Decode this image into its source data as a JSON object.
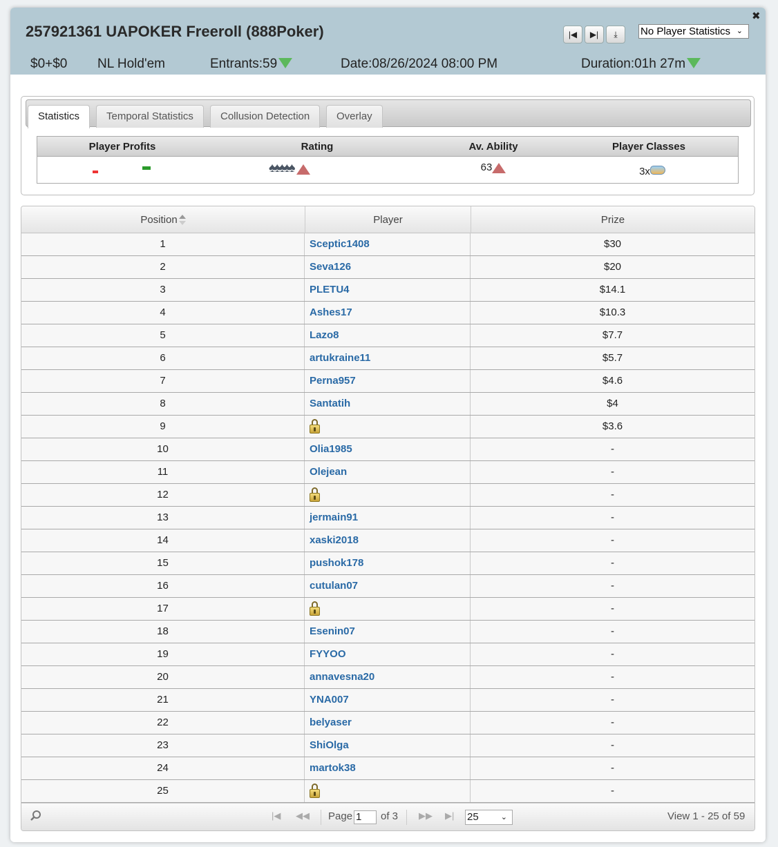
{
  "header": {
    "title": "257921361 UAPOKER Freeroll (888Poker)",
    "close_label": "✖",
    "stats_select": "No Player Statistics",
    "buyin": "$0+$0",
    "game": "NL Hold'em",
    "entrants": "Entrants:59",
    "date": "Date:08/26/2024 08:00 PM",
    "duration": "Duration:01h 27m"
  },
  "tabs": [
    "Statistics",
    "Temporal Statistics",
    "Collusion Detection",
    "Overlay"
  ],
  "summary": {
    "headers": [
      "Player Profits",
      "Rating",
      "Av. Ability",
      "Player Classes"
    ],
    "rating_icons": "♠♠♠♠♠",
    "ability": "63",
    "player_classes": "3x"
  },
  "grid": {
    "headers": [
      "Position",
      "Player",
      "Prize"
    ],
    "rows": [
      {
        "pos": "1",
        "player": "Sceptic1408",
        "prize": "$30"
      },
      {
        "pos": "2",
        "player": "Seva126",
        "prize": "$20"
      },
      {
        "pos": "3",
        "player": "PLETU4",
        "prize": "$14.1"
      },
      {
        "pos": "4",
        "player": "Ashes17",
        "prize": "$10.3"
      },
      {
        "pos": "5",
        "player": "Lazo8",
        "prize": "$7.7"
      },
      {
        "pos": "6",
        "player": "artukraine11",
        "prize": "$5.7"
      },
      {
        "pos": "7",
        "player": "Perna957",
        "prize": "$4.6"
      },
      {
        "pos": "8",
        "player": "Santatih",
        "prize": "$4"
      },
      {
        "pos": "9",
        "player": "",
        "prize": "$3.6"
      },
      {
        "pos": "10",
        "player": "Olia1985",
        "prize": "-"
      },
      {
        "pos": "11",
        "player": "Olejean",
        "prize": "-"
      },
      {
        "pos": "12",
        "player": "",
        "prize": "-"
      },
      {
        "pos": "13",
        "player": "jermain91",
        "prize": "-"
      },
      {
        "pos": "14",
        "player": "xaski2018",
        "prize": "-"
      },
      {
        "pos": "15",
        "player": "pushok178",
        "prize": "-"
      },
      {
        "pos": "16",
        "player": "cutulan07",
        "prize": "-"
      },
      {
        "pos": "17",
        "player": "",
        "prize": "-"
      },
      {
        "pos": "18",
        "player": "Esenin07",
        "prize": "-"
      },
      {
        "pos": "19",
        "player": "FYYOO",
        "prize": "-"
      },
      {
        "pos": "20",
        "player": "annavesna20",
        "prize": "-"
      },
      {
        "pos": "21",
        "player": "YNA007",
        "prize": "-"
      },
      {
        "pos": "22",
        "player": "belyaser",
        "prize": "-"
      },
      {
        "pos": "23",
        "player": "ShiOlga",
        "prize": "-"
      },
      {
        "pos": "24",
        "player": "martok38",
        "prize": "-"
      },
      {
        "pos": "25",
        "player": "",
        "prize": "-"
      }
    ]
  },
  "pager": {
    "page_label": "Page",
    "page_value": "1",
    "of_label": "of 3",
    "rows_value": "25",
    "view_text": "View 1 - 25 of 59"
  },
  "colors": {
    "header_bg": "#b3c9d3",
    "link": "#2a6aa6",
    "down_arrow": "#5cb85c",
    "up_arrow": "#c76b6b"
  }
}
